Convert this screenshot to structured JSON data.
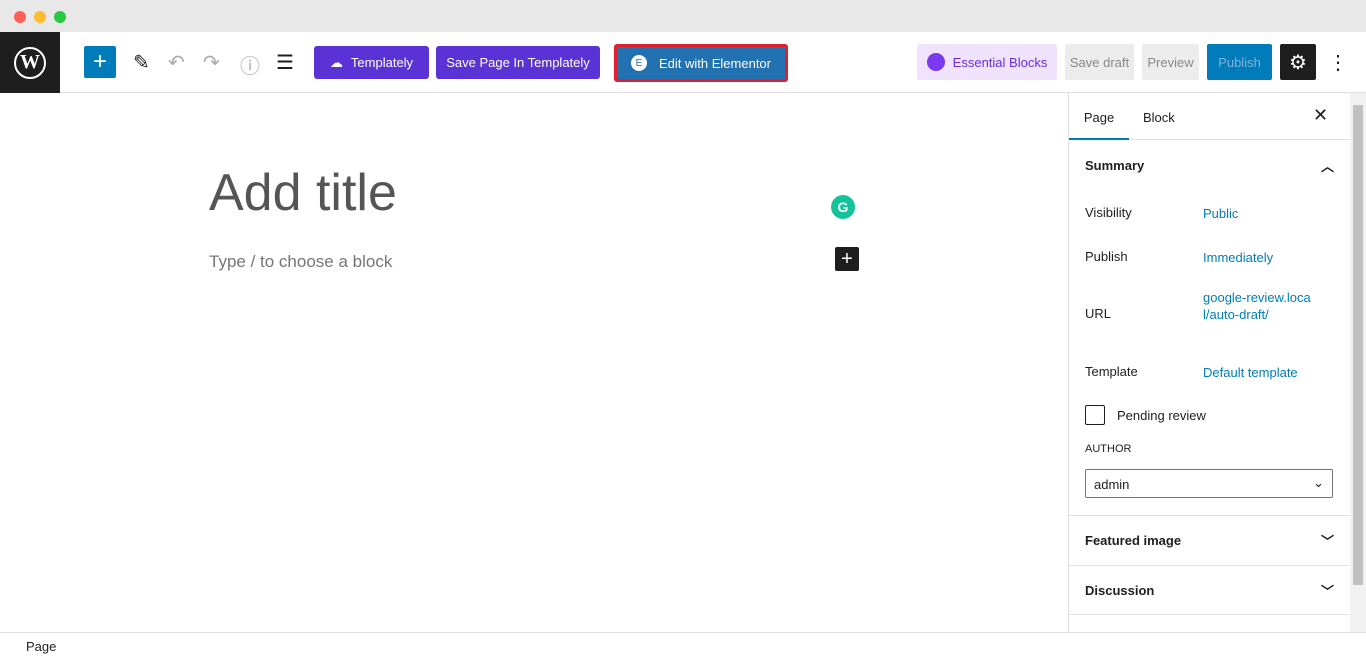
{
  "toolbar": {
    "logo": "W",
    "add": "+",
    "templately": "Templately",
    "save_templately": "Save Page In Templately",
    "elementor": "Edit with Elementor",
    "essential": "Essential Blocks",
    "save_draft": "Save draft",
    "preview": "Preview",
    "publish": "Publish",
    "more": "⋮"
  },
  "editor": {
    "title_placeholder": "Add title",
    "block_placeholder": "Type / to choose a block"
  },
  "sidebar": {
    "tabs": [
      "Page",
      "Block"
    ],
    "summary": "Summary",
    "rows": [
      {
        "label": "Visibility",
        "value": "Public"
      },
      {
        "label": "Publish",
        "value": "Immediately"
      },
      {
        "label": "URL",
        "value": "google-review.local/auto-draft/"
      },
      {
        "label": "Template",
        "value": "Default template"
      }
    ],
    "pending": "Pending review",
    "author_label": "AUTHOR",
    "author": "admin",
    "featured": "Featured image",
    "discussion": "Discussion"
  },
  "footer": {
    "breadcrumb": "Page"
  },
  "colors": {
    "accent": "#007cba",
    "purple": "#5b32d6",
    "highlight": "#e0202f"
  }
}
